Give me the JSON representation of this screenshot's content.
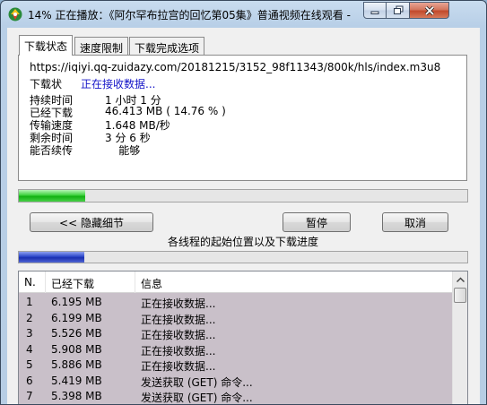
{
  "window": {
    "title": "14% 正在播放：《阿尔罕布拉宫的回忆第05集》普通视频在线观看 -"
  },
  "tabs": [
    {
      "label": "下载状态"
    },
    {
      "label": "速度限制"
    },
    {
      "label": "下载完成选项"
    }
  ],
  "status": {
    "url": "https://iqiyi.qq-zuidazy.com/20181215/3152_98f11343/800k/hls/index.m3u8",
    "status_label": "下载状",
    "status_value": "正在接收数据...",
    "fields": [
      {
        "label": "持续时间",
        "value": "1 小时 1 分"
      },
      {
        "label": "已经下载",
        "value": "46.413  MB  ( 14.76 % )"
      },
      {
        "label": "传输速度",
        "value": "1.648  MB/秒"
      },
      {
        "label": "剩余时间",
        "value": "3 分 6 秒"
      },
      {
        "label": "能否续传",
        "value": "    能够"
      }
    ]
  },
  "progress": {
    "overall": 0.1476,
    "threads_fraction": 0.145
  },
  "buttons": {
    "hide_details": "<< 隐藏细节",
    "pause": "暂停",
    "cancel": "取消"
  },
  "thread_caption": "各线程的起始位置以及下载进度",
  "list": {
    "columns": [
      "N.",
      "已经下载",
      "信息"
    ],
    "rows": [
      [
        "1",
        "6.195  MB",
        "正在接收数据..."
      ],
      [
        "2",
        "6.199  MB",
        "正在接收数据..."
      ],
      [
        "3",
        "5.526  MB",
        "正在接收数据..."
      ],
      [
        "4",
        "5.908  MB",
        "正在接收数据..."
      ],
      [
        "5",
        "5.886  MB",
        "正在接收数据..."
      ],
      [
        "6",
        "5.419  MB",
        "发送获取 (GET) 命令..."
      ],
      [
        "7",
        "5.398  MB",
        "发送获取 (GET) 命令..."
      ]
    ]
  },
  "colors": {
    "progress_green": "#12b012",
    "progress_blue": "#1a2fb0",
    "status_blue": "#1515c8",
    "list_bg": "#c9c0c9"
  }
}
